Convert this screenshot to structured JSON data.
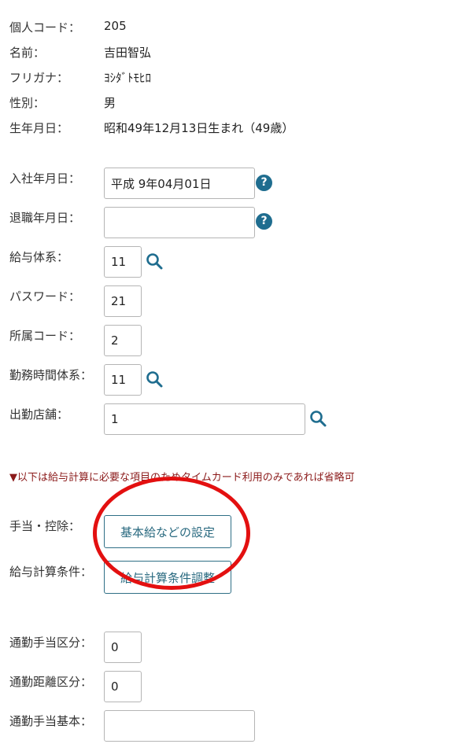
{
  "profile": {
    "code_label": "個人コード：",
    "code_value": "205",
    "name_label": "名前：",
    "name_value": "吉田智弘",
    "kana_label": "フリガナ：",
    "kana_value": "ﾖｼﾀﾞﾄﾓﾋﾛ",
    "gender_label": "性別：",
    "gender_value": "男",
    "birth_label": "生年月日：",
    "birth_value": "昭和49年12月13日生まれ（49歳）"
  },
  "form": {
    "hire_date_label": "入社年月日：",
    "hire_date_value": "平成 9年04月01日",
    "retire_date_label": "退職年月日：",
    "retire_date_value": "",
    "pay_system_label": "給与体系：",
    "pay_system_value": "11",
    "password_label": "パスワード：",
    "password_value": "21",
    "dept_code_label": "所属コード：",
    "dept_code_value": "2",
    "work_time_label": "勤務時間体系：",
    "work_time_value": "11",
    "store_label": "出勤店舗：",
    "store_value": "1"
  },
  "notice": "▼以下は給与計算に必要な項目のためタイムカード利用のみであれば省略可",
  "payroll": {
    "allowance_label": "手当・控除：",
    "allowance_button": "基本給などの設定",
    "calc_label": "給与計算条件：",
    "calc_button": "給与計算条件調整"
  },
  "commute": {
    "type_label": "通勤手当区分：",
    "type_value": "0",
    "distance_label": "通勤距離区分：",
    "distance_value": "0",
    "base_label": "通勤手当基本：",
    "base_value": ""
  },
  "icons": {
    "help": "question-circle-icon",
    "search": "magnifier-icon",
    "help_glyph": "?"
  },
  "colors": {
    "accent": "#1f6d8f",
    "notice": "#8b1a1a",
    "annotation": "#e31010"
  }
}
